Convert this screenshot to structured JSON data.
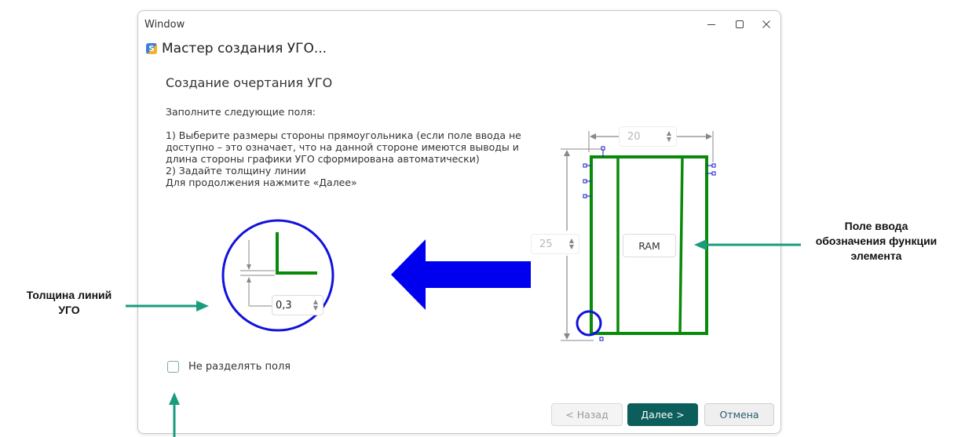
{
  "window": {
    "title": "Window",
    "controls": {
      "minimize": "—",
      "maximize": "☐",
      "close": "✕"
    }
  },
  "app": {
    "title": "Мастер создания УГО...",
    "icon_letter": "S"
  },
  "page": {
    "heading": "Создание очертания УГО",
    "instructions": [
      "Заполните следующие поля:",
      "1)    Выберите размеры стороны прямоугольника (если поле ввода не",
      "доступно – это означает, что на данной стороне имеются выводы и",
      "длина стороны графики УГО сформирована автоматически)",
      "2)    Задайте толщину линии",
      "Для продолжения нажмите «Далее»"
    ]
  },
  "fields": {
    "width_value": "20",
    "height_value": "25",
    "line_thickness_value": "0,3",
    "function_label": "RAM",
    "spin_up": "▲",
    "spin_down": "▼"
  },
  "checkbox": {
    "label": "Не разделять поля",
    "checked": false
  },
  "buttons": {
    "back": "< Назад",
    "next": "Далее >",
    "cancel": "Отмена"
  },
  "annotations": {
    "line_thickness": [
      "Толщина линий",
      "УГО"
    ],
    "function_field": [
      "Поле ввода",
      "обозначения функции",
      "элемента"
    ]
  },
  "colors": {
    "accent_teal": "#1a9c7c",
    "shape_green": "#0a8a0a",
    "highlight_blue": "#0000ee",
    "primary_button": "#0c5e5c"
  }
}
